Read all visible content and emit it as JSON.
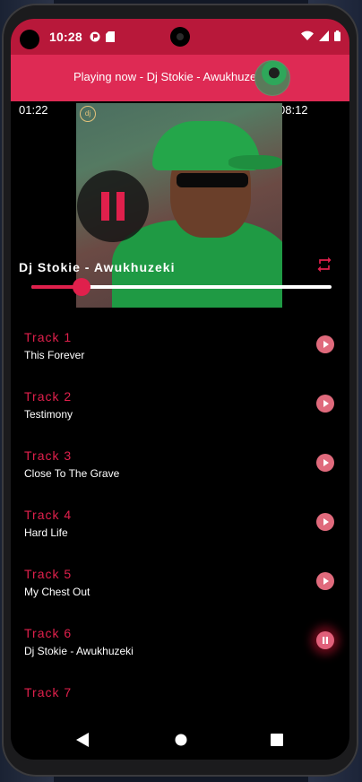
{
  "status_bar": {
    "time": "10:28"
  },
  "app_bar": {
    "title": "Playing now - Dj Stokie - Awukhuze..."
  },
  "player": {
    "elapsed": "01:22",
    "duration": "08:12",
    "title": "Dj Stokie - Awukhuzeki",
    "progress": 0.168,
    "state": "playing",
    "cover_logo": "dj"
  },
  "tracks": [
    {
      "number": "Track 1",
      "name": "This Forever",
      "button": "play"
    },
    {
      "number": "Track 2",
      "name": "Testimony",
      "button": "play"
    },
    {
      "number": "Track 3",
      "name": "Close To The Grave",
      "button": "play"
    },
    {
      "number": "Track 4",
      "name": "Hard Life",
      "button": "play"
    },
    {
      "number": "Track 5",
      "name": "My Chest Out",
      "button": "play"
    },
    {
      "number": "Track 6",
      "name": "Dj Stokie - Awukhuzeki",
      "button": "pause"
    },
    {
      "number": "Track 7",
      "name": "",
      "button": "none"
    }
  ],
  "icons": {
    "status": [
      "data-saver-icon",
      "sd-card-icon",
      "wifi-icon",
      "cellular-icon",
      "battery-icon"
    ],
    "player": [
      "pause-icon",
      "repeat-icon"
    ],
    "nav": [
      "back-icon",
      "home-icon",
      "recents-icon"
    ]
  },
  "colors": {
    "accent": "#de2a54",
    "status_bar": "#b8183a",
    "track_button": "#e06a7c",
    "background": "#000000"
  }
}
